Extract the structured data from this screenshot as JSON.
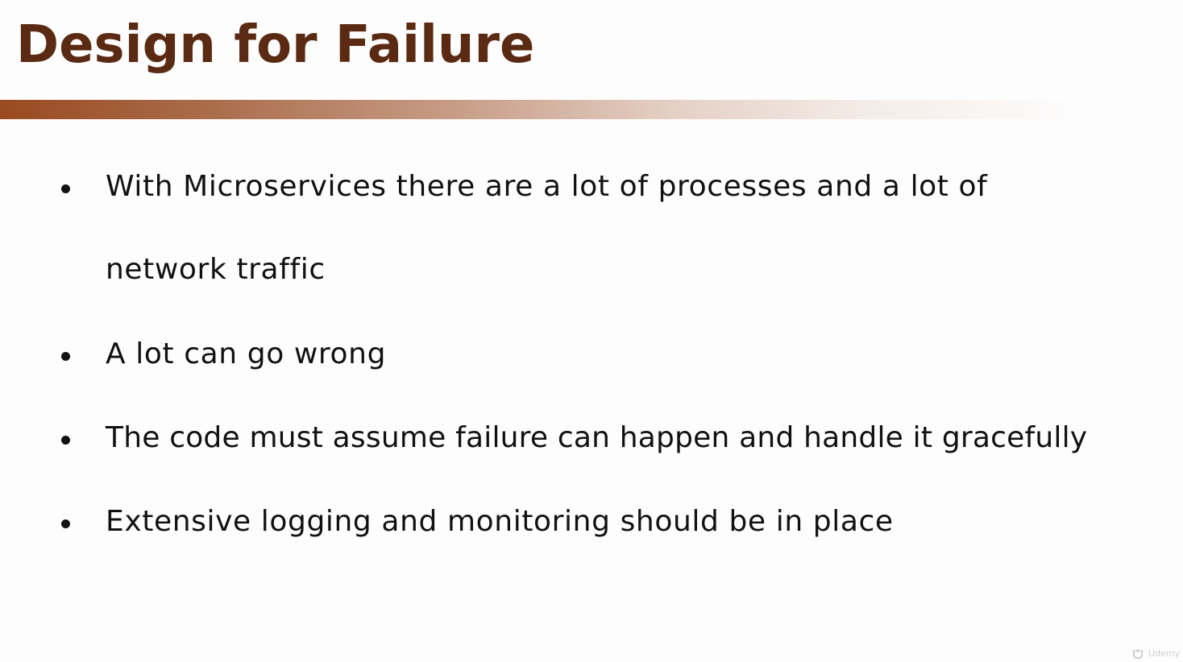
{
  "slide": {
    "title": "Design for Failure",
    "colors": {
      "title": "#5a2a12",
      "rule_start": "#9a4a20",
      "text": "#111111",
      "background": "#fdfdfd"
    },
    "bullets": [
      {
        "lines": [
          "With Microservices there are a lot of processes and a lot of",
          "network traffic"
        ]
      },
      {
        "lines": [
          "A lot can go wrong"
        ]
      },
      {
        "lines": [
          "The code must assume failure can happen and handle it gracefully"
        ]
      },
      {
        "lines": [
          "Extensive logging and monitoring should be in place"
        ]
      }
    ]
  },
  "watermark": {
    "icon": "udemy-logo-icon",
    "text": "Udemy"
  }
}
